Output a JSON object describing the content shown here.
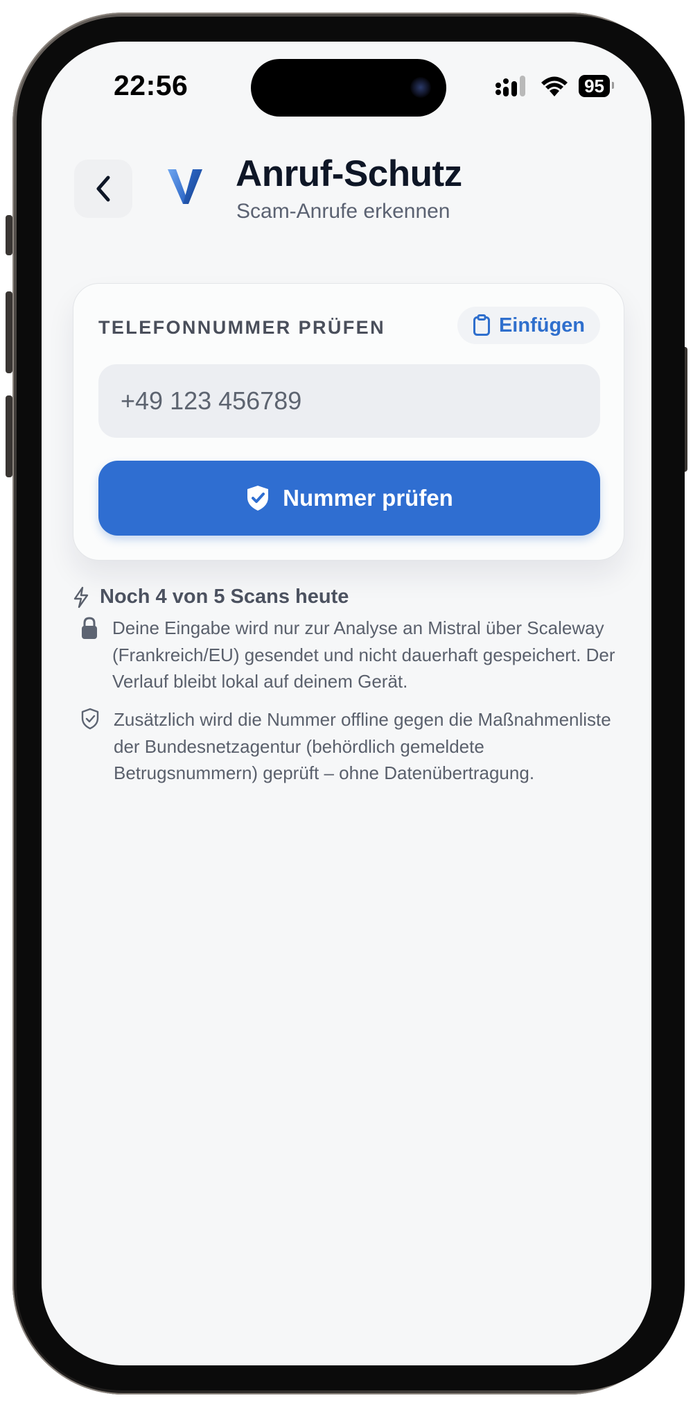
{
  "status_bar": {
    "time": "22:56",
    "battery": "95"
  },
  "header": {
    "title": "Anruf-Schutz",
    "subtitle": "Scam-Anrufe erkennen"
  },
  "check_card": {
    "label": "TELEFONNUMMER PRÜFEN",
    "paste_label": "Einfügen",
    "input_placeholder": "+49 123 456789",
    "input_value": "",
    "submit_label": "Nummer prüfen"
  },
  "scan_quota": {
    "text": "Noch 4 von 5 Scans heute"
  },
  "info": {
    "privacy": "Deine Eingabe wird nur zur Analyse an Mistral über Scaleway (Frankreich/EU) gesendet und nicht dauerhaft gespeichert. Der Verlauf bleibt lokal auf deinem Gerät.",
    "offline_check": "Zusätzlich wird die Nummer offline gegen die Maßnahmenliste der Bundesnetzagentur (behördlich gemeldete Betrugsnummern) geprüft – ohne Datenübertragung."
  },
  "colors": {
    "accent": "#2f6ed1",
    "title": "#0e1626",
    "background": "#f6f7f8"
  },
  "icons": {
    "back": "chevron-left-icon",
    "logo": "app-logo-v",
    "paste": "clipboard-icon",
    "submit": "shield-check-icon",
    "quota": "bolt-icon",
    "privacy": "lock-icon",
    "offline": "shield-check-outline-icon"
  }
}
